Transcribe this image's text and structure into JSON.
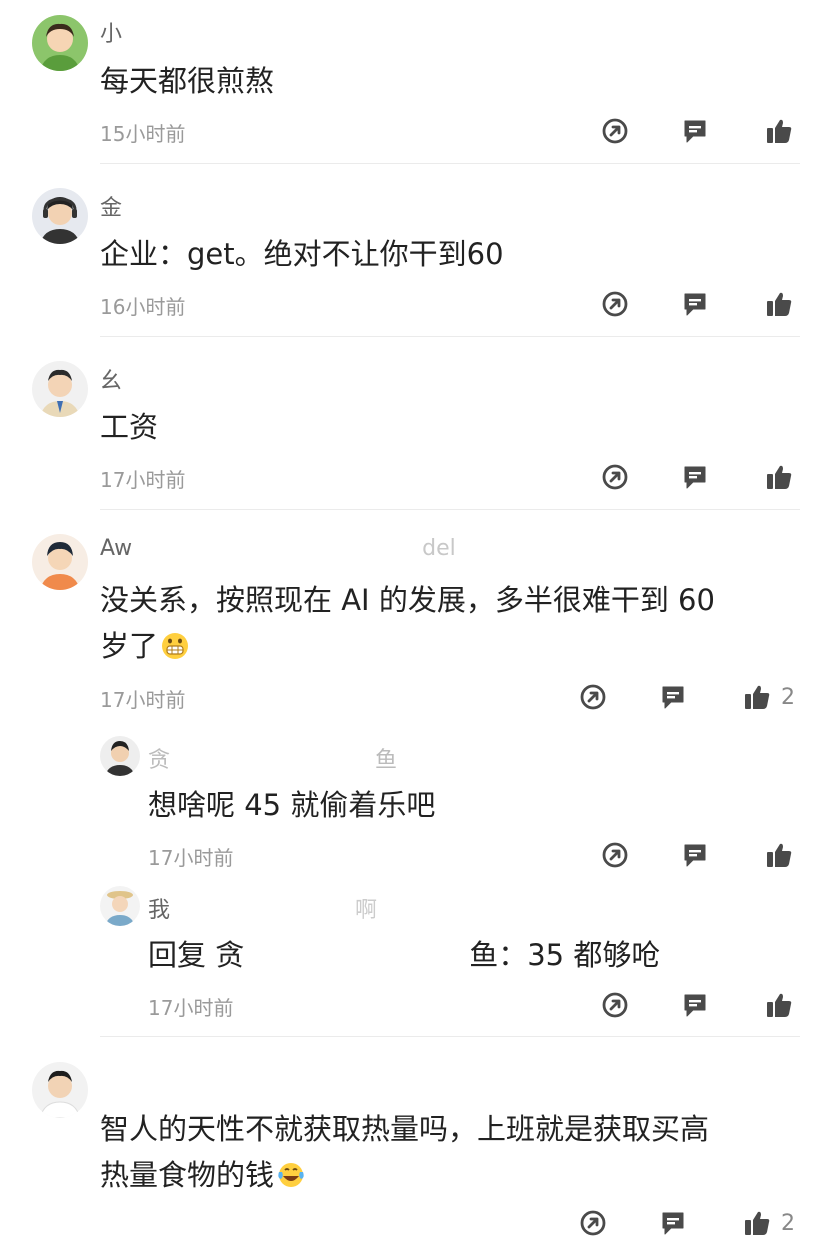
{
  "comments": [
    {
      "user": "小",
      "text": "每天都很煎熬",
      "time": "15小时前"
    },
    {
      "user": "金",
      "text": "企业：get。绝对不让你干到60",
      "time": "16小时前"
    },
    {
      "user": "幺",
      "text": "工资",
      "time": "17小时前"
    },
    {
      "user": "Aw",
      "user_tail": "del",
      "text_line1": "没关系，按照现在 AI 的发展，多半很难干到 60",
      "text_line2": "岁了",
      "emoji": "grimacing-emoji",
      "time": "17小时前",
      "likes": "2"
    },
    {
      "user": "贪",
      "user_tail": "鱼",
      "text": "想啥呢 45 就偷着乐吧",
      "time": "17小时前"
    },
    {
      "user": "我",
      "user_tail": "啊",
      "reply_prefix": "回复 贪",
      "reply_mid": "鱼：",
      "reply_text": "35 都够呛",
      "time": "17小时前"
    },
    {
      "user": "",
      "text_line1": "智人的天性不就获取热量吗，上班就是获取买高",
      "text_line2": "热量食物的钱",
      "emoji": "tears-of-joy-emoji",
      "time": "",
      "likes": "2"
    }
  ],
  "colors": {
    "text": "#222222",
    "meta": "#9a9a9a",
    "icon": "#4a4a4a",
    "divider": "#ebebeb"
  },
  "icons": [
    "share-icon",
    "reply-icon",
    "like-icon"
  ]
}
